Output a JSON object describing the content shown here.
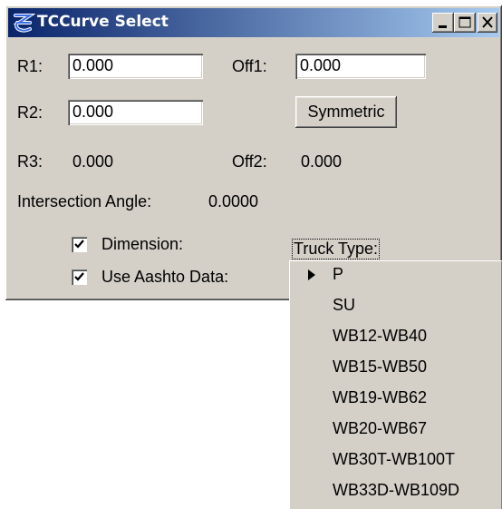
{
  "window": {
    "title": "TCCurve Select",
    "app_icon": "tc-logo-icon",
    "controls": {
      "minimize_icon": "minimize-icon",
      "maximize_icon": "maximize-icon",
      "close_icon": "close-icon"
    }
  },
  "fields": {
    "r1": {
      "label": "R1:",
      "value": "0.000"
    },
    "off1": {
      "label": "Off1:",
      "value": "0.000"
    },
    "r2": {
      "label": "R2:",
      "value": "0.000"
    },
    "symmetric_button": "Symmetric"
  },
  "readouts": {
    "r3": {
      "label": "R3:",
      "value": "0.000"
    },
    "off2": {
      "label": "Off2:",
      "value": "0.000"
    },
    "intersection_angle": {
      "label": "Intersection Angle:",
      "value": "0.0000"
    }
  },
  "checkboxes": {
    "dimension": {
      "label": "Dimension:",
      "checked": true
    },
    "use_aashto": {
      "label": "Use Aashto Data:",
      "checked": true
    }
  },
  "truck_type": {
    "label": "Truck Type:",
    "selected": "P",
    "options": [
      "P",
      "SU",
      "WB12-WB40",
      "WB15-WB50",
      "WB19-WB62",
      "WB20-WB67",
      "WB30T-WB100T",
      "WB33D-WB109D"
    ]
  }
}
